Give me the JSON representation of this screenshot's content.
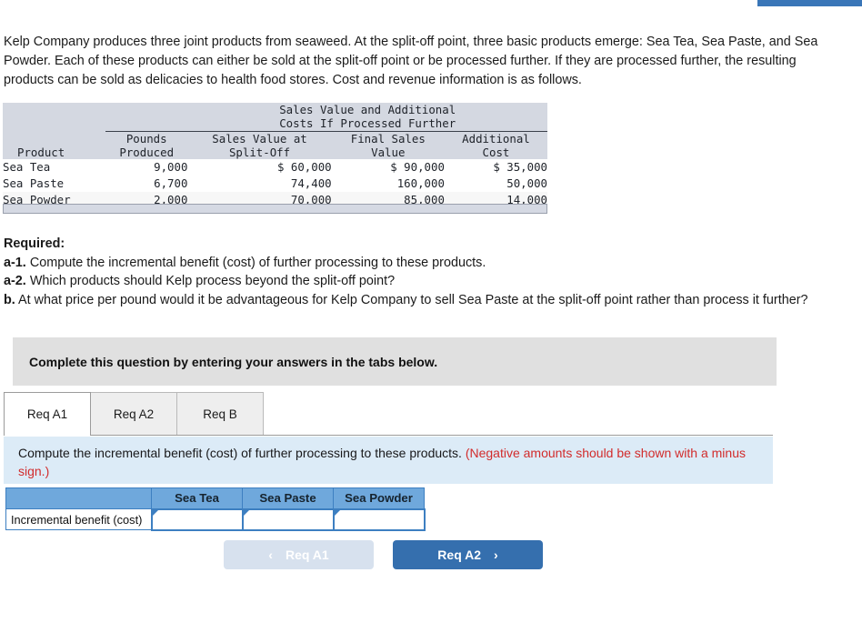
{
  "top_bar": {
    "color": "#3a76b8"
  },
  "problem": {
    "text": "Kelp Company produces three joint products from seaweed. At the split-off point, three basic products emerge: Sea Tea, Sea Paste, and Sea Powder. Each of these products can either be sold at the split-off point or be processed further. If they are processed further, the resulting products can be sold as delicacies to health food stores. Cost and revenue information is as follows."
  },
  "data_table": {
    "group_header_line1": "Sales Value and Additional",
    "group_header_line2": "Costs If Processed Further",
    "columns": [
      {
        "line1": "",
        "line2": "Product"
      },
      {
        "line1": "Pounds",
        "line2": "Produced"
      },
      {
        "line1": "Sales Value at",
        "line2": "Split-Off"
      },
      {
        "line1": "Final Sales",
        "line2": "Value"
      },
      {
        "line1": "Additional",
        "line2": "Cost"
      }
    ],
    "rows": [
      {
        "product": "Sea Tea",
        "pounds": "9,000",
        "split_off": "$ 60,000",
        "final_sales": "$ 90,000",
        "additional_cost": "$ 35,000"
      },
      {
        "product": "Sea Paste",
        "pounds": "6,700",
        "split_off": "74,400",
        "final_sales": "160,000",
        "additional_cost": "50,000"
      },
      {
        "product": "Sea Powder",
        "pounds": "2,000",
        "split_off": "70,000",
        "final_sales": "85,000",
        "additional_cost": "14,000"
      }
    ]
  },
  "required": {
    "heading": "Required:",
    "items": [
      {
        "label": "a-1.",
        "text": "Compute the incremental benefit (cost) of further processing to these products."
      },
      {
        "label": "a-2.",
        "text": "Which products should Kelp process beyond the split-off point?"
      },
      {
        "label": "b.",
        "text": "At what price per pound would it be advantageous for Kelp Company to sell Sea Paste at the split-off point rather than process it further?"
      }
    ]
  },
  "banner": {
    "text": "Complete this question by entering your answers in the tabs below."
  },
  "tabs": [
    {
      "label": "Req A1",
      "active": true
    },
    {
      "label": "Req A2",
      "active": false
    },
    {
      "label": "Req B",
      "active": false
    }
  ],
  "instruction": {
    "main": "Compute the incremental benefit (cost) of further processing to these products.",
    "note": "(Negative amounts should be shown with a minus sign.)",
    "note_color": "#d22c2c"
  },
  "answer_table": {
    "corner": "",
    "headers": [
      "Sea Tea",
      "Sea Paste",
      "Sea Powder"
    ],
    "row_label": "Incremental benefit (cost)",
    "values": [
      "",
      "",
      ""
    ]
  },
  "nav": {
    "prev": {
      "label": "Req A1",
      "icon": "chevron-left",
      "glyph": "‹",
      "disabled": true
    },
    "next": {
      "label": "Req A2",
      "icon": "chevron-right",
      "glyph": "›",
      "disabled": false
    }
  }
}
